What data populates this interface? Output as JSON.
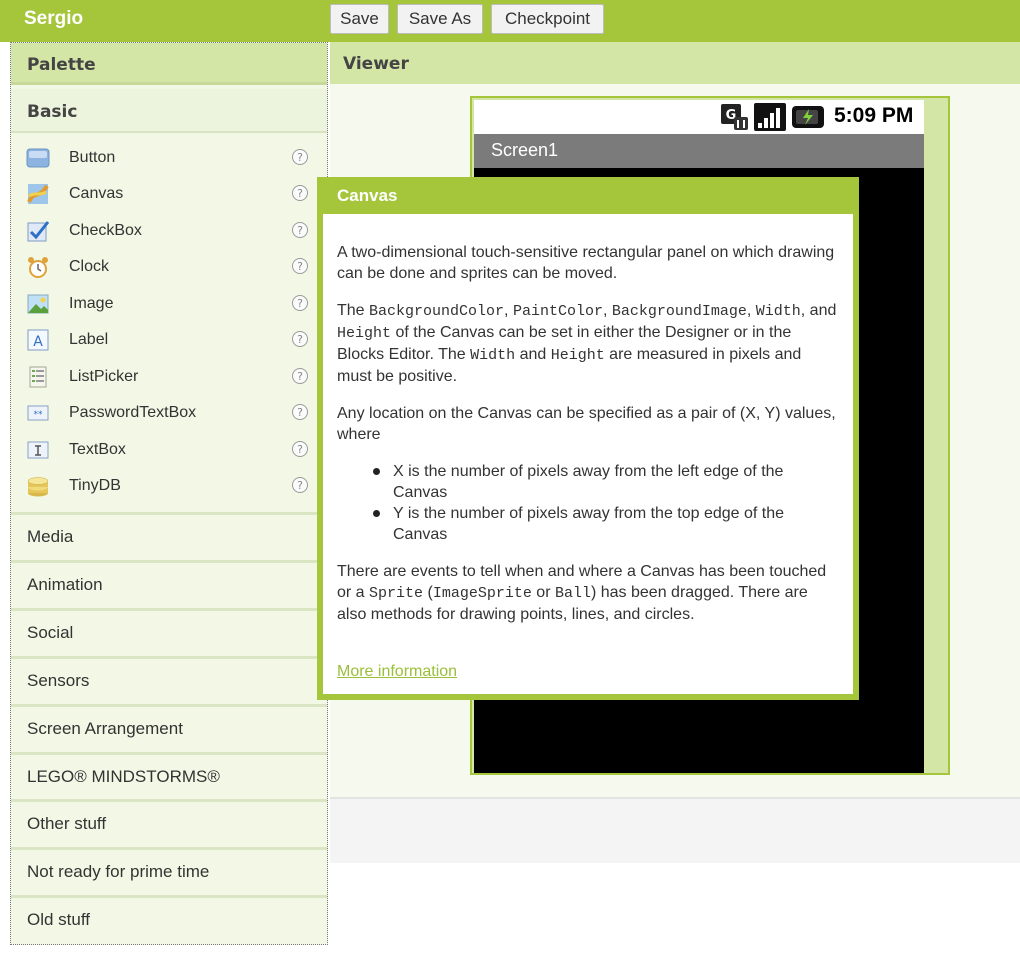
{
  "topbar": {
    "project_name": "Sergio",
    "buttons": {
      "save": "Save",
      "save_as": "Save As",
      "checkpoint": "Checkpoint"
    }
  },
  "palette": {
    "title": "Palette",
    "basic_title": "Basic",
    "help_glyph": "?",
    "components": [
      {
        "label": "Button",
        "icon": "button-icon"
      },
      {
        "label": "Canvas",
        "icon": "canvas-icon"
      },
      {
        "label": "CheckBox",
        "icon": "checkbox-icon"
      },
      {
        "label": "Clock",
        "icon": "clock-icon"
      },
      {
        "label": "Image",
        "icon": "image-icon"
      },
      {
        "label": "Label",
        "icon": "label-icon"
      },
      {
        "label": "ListPicker",
        "icon": "listpicker-icon"
      },
      {
        "label": "PasswordTextBox",
        "icon": "password-textbox-icon"
      },
      {
        "label": "TextBox",
        "icon": "textbox-icon"
      },
      {
        "label": "TinyDB",
        "icon": "database-icon"
      }
    ],
    "categories": [
      "Media",
      "Animation",
      "Social",
      "Sensors",
      "Screen Arrangement",
      "LEGO® MINDSTORMS®",
      "Other stuff",
      "Not ready for prime time",
      "Old stuff"
    ]
  },
  "viewer": {
    "title": "Viewer",
    "status_time": "5:09 PM",
    "screen_title": "Screen1"
  },
  "popup": {
    "title": "Canvas",
    "p1": "A two-dimensional touch-sensitive rectangular panel on which drawing can be done and sprites can be moved.",
    "p2": {
      "t1": "The ",
      "c1": "BackgroundColor",
      "t2": ", ",
      "c2": "PaintColor",
      "t3": ", ",
      "c3": "BackgroundImage",
      "t4": ", ",
      "c4": "Width",
      "t5": ", and ",
      "c5": "Height",
      "t6": " of the Canvas can be set in either the Designer or in the Blocks Editor. The ",
      "c6": "Width",
      "t7": " and ",
      "c7": "Height",
      "t8": " are measured in pixels and must be positive."
    },
    "p3": "Any location on the Canvas can be specified as a pair of (X, Y) values, where",
    "bullets": [
      "X is the number of pixels away from the left edge of the Canvas",
      "Y is the number of pixels away from the top edge of the Canvas"
    ],
    "p4": {
      "t1": "There are events to tell when and where a Canvas has been touched or a ",
      "c1": "Sprite",
      "t2": " (",
      "c2": "ImageSprite",
      "t3": " or ",
      "c3": "Ball",
      "t4": ") has been dragged. There are also methods for drawing points, lines, and circles."
    },
    "more_link": "More information"
  },
  "colors": {
    "accent": "#a5c63b",
    "header_light": "#d4e6a6",
    "palette_bg": "#f3f8e6",
    "link": "#9bbf3a"
  }
}
